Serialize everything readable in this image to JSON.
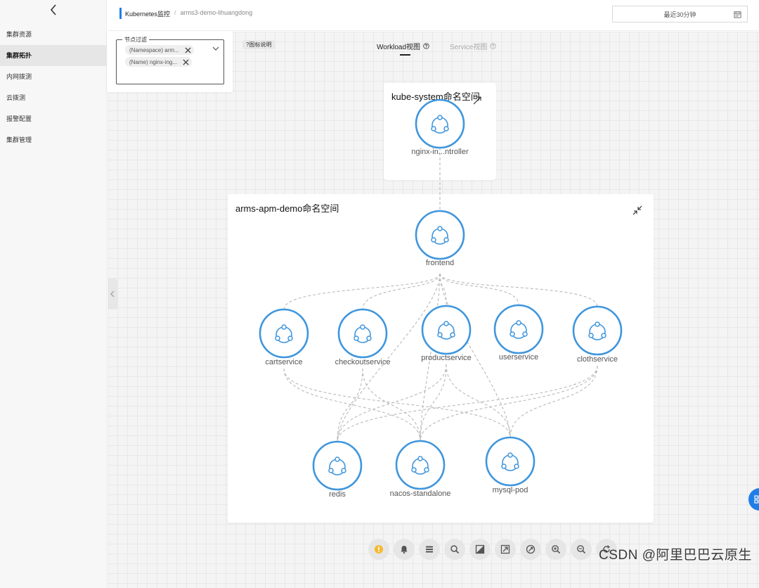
{
  "sidebar": {
    "items": [
      {
        "label": "集群资源",
        "active": false
      },
      {
        "label": "集群拓扑",
        "active": true
      },
      {
        "label": "内网拨测",
        "active": false
      },
      {
        "label": "云拨测",
        "active": false
      },
      {
        "label": "报警配置",
        "active": false
      },
      {
        "label": "集群管理",
        "active": false
      }
    ]
  },
  "header": {
    "breadcrumb_root": "Kubernetes监控",
    "breadcrumb_sep": "/",
    "breadcrumb_leaf": "arms3-demo-lihuangdong",
    "time_range": "最近30分钟"
  },
  "filter": {
    "legend": "节点过滤",
    "chips": [
      "(Namespace) arm...",
      "(Name) nginx-ing..."
    ]
  },
  "legend_button": "?图标说明",
  "tabs": {
    "workload": "Workload视图",
    "service": "Service视图"
  },
  "namespaces": {
    "kube": "kube-system命名空间",
    "arms": "arms-apm-demo命名空间"
  },
  "nodes": [
    {
      "id": "nginx",
      "label": "nginx-in...ntroller"
    },
    {
      "id": "frontend",
      "label": "frontend"
    },
    {
      "id": "cartservice",
      "label": "cartservice"
    },
    {
      "id": "checkoutservice",
      "label": "checkoutservice"
    },
    {
      "id": "productservice",
      "label": "productservice"
    },
    {
      "id": "userservice",
      "label": "userservice"
    },
    {
      "id": "clothservice",
      "label": "clothservice"
    },
    {
      "id": "redis",
      "label": "redis"
    },
    {
      "id": "nacos",
      "label": "nacos-standalone"
    },
    {
      "id": "mysql",
      "label": "mysql-pod"
    }
  ],
  "edges": [
    [
      "nginx",
      "frontend"
    ],
    [
      "frontend",
      "cartservice"
    ],
    [
      "frontend",
      "checkoutservice"
    ],
    [
      "frontend",
      "productservice"
    ],
    [
      "frontend",
      "userservice"
    ],
    [
      "frontend",
      "clothservice"
    ],
    [
      "frontend",
      "redis"
    ],
    [
      "frontend",
      "nacos"
    ],
    [
      "frontend",
      "mysql"
    ],
    [
      "cartservice",
      "nacos"
    ],
    [
      "cartservice",
      "mysql"
    ],
    [
      "checkoutservice",
      "redis"
    ],
    [
      "checkoutservice",
      "nacos"
    ],
    [
      "productservice",
      "redis"
    ],
    [
      "productservice",
      "nacos"
    ],
    [
      "productservice",
      "mysql"
    ],
    [
      "clothservice",
      "redis"
    ],
    [
      "clothservice",
      "nacos"
    ],
    [
      "clothservice",
      "mysql"
    ]
  ],
  "toolbar": [
    "warning-icon",
    "alarm-bell-icon",
    "list-icon",
    "search-icon",
    "layout-icon",
    "fit-view-icon",
    "reset-view-icon",
    "zoom-in-icon",
    "zoom-out-icon",
    "refresh-icon"
  ],
  "watermark": "CSDN @阿里巴巴云原生",
  "colors": {
    "accent": "#1f7ee8",
    "node_stroke": "#3f96dd",
    "edge": "#b9b9b9",
    "warning": "#f5b82e"
  }
}
